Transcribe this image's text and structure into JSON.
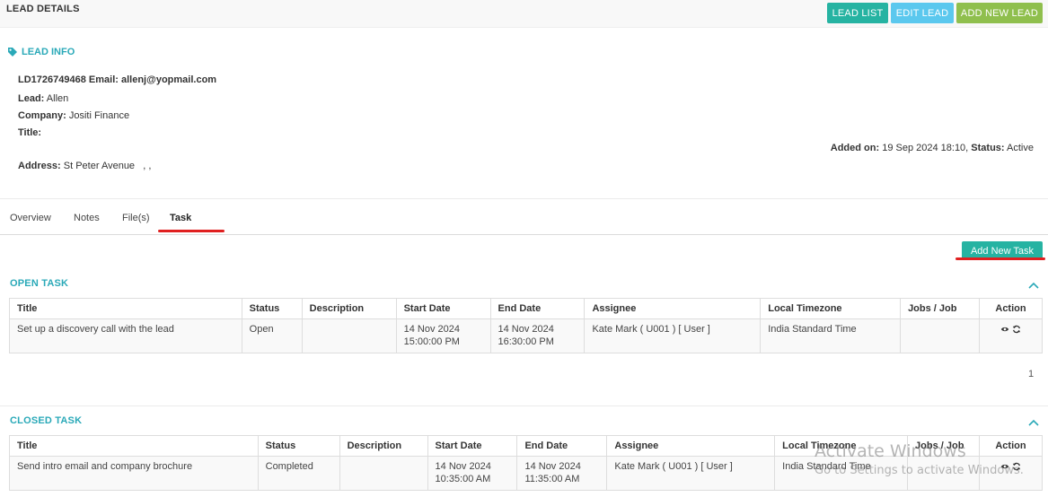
{
  "header": {
    "title": "LEAD DETAILS",
    "buttons": {
      "lead_list": "LEAD LIST",
      "edit_lead": "EDIT LEAD",
      "add_new_lead": "ADD NEW LEAD"
    }
  },
  "lead_info": {
    "heading": "LEAD INFO",
    "id": "LD1726749468",
    "email_label": "Email:",
    "email": "allenj@yopmail.com",
    "lead_label": "Lead:",
    "lead": "Allen",
    "company_label": "Company:",
    "company": "Jositi Finance",
    "title_label": "Title:",
    "title": "",
    "address_label": "Address:",
    "address": "St Peter Avenue   , ,",
    "added_on_label": "Added on:",
    "added_on": "19 Sep 2024 18:10,",
    "status_label": "Status:",
    "status": "Active"
  },
  "tabs": [
    "Overview",
    "Notes",
    "File(s)",
    "Task"
  ],
  "active_tab": "Task",
  "add_task_label": "Add New Task",
  "open_task": {
    "heading": "OPEN TASK",
    "columns": [
      "Title",
      "Status",
      "Description",
      "Start Date",
      "End Date",
      "Assignee",
      "Local Timezone",
      "Jobs / Job",
      "Action"
    ],
    "rows": [
      {
        "title": "Set up a discovery call with the lead",
        "status": "Open",
        "description": "",
        "start_date": "14 Nov 2024",
        "start_time": "15:00:00 PM",
        "end_date": "14 Nov 2024",
        "end_time": "16:30:00 PM",
        "assignee": "Kate Mark ( U001 ) [ User ]",
        "timezone": "India Standard Time",
        "jobs": ""
      }
    ],
    "page": "1"
  },
  "closed_task": {
    "heading": "CLOSED TASK",
    "columns": [
      "Title",
      "Status",
      "Description",
      "Start Date",
      "End Date",
      "Assignee",
      "Local Timezone",
      "Jobs / Job",
      "Action"
    ],
    "rows": [
      {
        "title": "Send intro email and company brochure",
        "status": "Completed",
        "description": "",
        "start_date": "14 Nov 2024",
        "start_time": "10:35:00 AM",
        "end_date": "14 Nov 2024",
        "end_time": "11:35:00 AM",
        "assignee": "Kate Mark ( U001 ) [ User ]",
        "timezone": "India Standard Time",
        "jobs": ""
      }
    ]
  },
  "watermark": {
    "line1": "Activate Windows",
    "line2": "Go to Settings to activate Windows."
  },
  "colors": {
    "teal": "#26b3a2",
    "sky": "#5bc8ee",
    "green": "#8fbf4d",
    "heading": "#2aa9b8",
    "annotation_red": "#e02020"
  },
  "icons": {
    "lead_info": "tag-icon",
    "view": "eye-icon",
    "refresh": "refresh-icon",
    "collapse": "chevron-up-icon"
  }
}
